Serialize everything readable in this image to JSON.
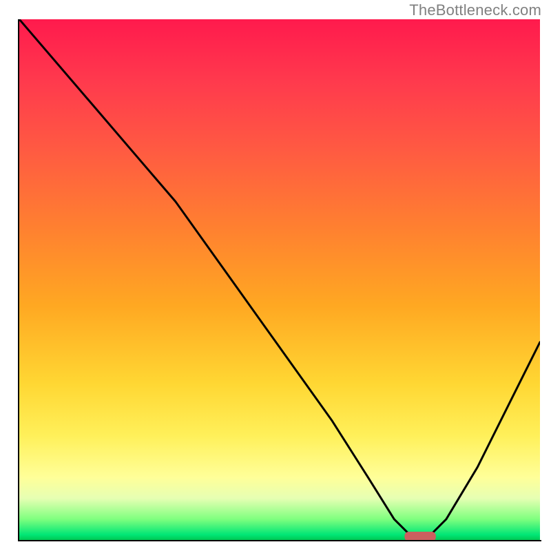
{
  "watermark": "TheBottleneck.com",
  "colors": {
    "gradient_top": "#ff1a4d",
    "gradient_mid": "#ffd733",
    "gradient_bottom": "#00c853",
    "curve": "#000000",
    "marker": "#cc5f5f",
    "axis": "#000000",
    "watermark_text": "#808080"
  },
  "chart_data": {
    "type": "line",
    "title": "",
    "xlabel": "",
    "ylabel": "",
    "xlim": [
      0,
      100
    ],
    "ylim": [
      0,
      100
    ],
    "grid": false,
    "legend": false,
    "series": [
      {
        "name": "bottleneck-curve",
        "x": [
          0,
          12,
          24,
          30,
          40,
          50,
          60,
          67,
          72,
          76,
          78,
          82,
          88,
          94,
          100
        ],
        "values": [
          100,
          86,
          72,
          65,
          51,
          37,
          23,
          12,
          4,
          0,
          0,
          4,
          14,
          26,
          38
        ]
      }
    ],
    "marker": {
      "x_start": 74,
      "x_end": 80,
      "y": 0
    }
  }
}
